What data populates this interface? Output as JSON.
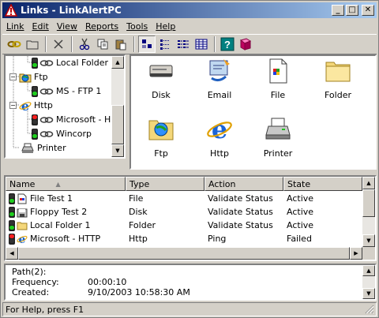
{
  "window": {
    "title": "Links - LinkAlertPC",
    "minimize": "_",
    "maximize": "□",
    "close": "✕"
  },
  "menu": [
    {
      "label": "Link"
    },
    {
      "label": "Edit"
    },
    {
      "label": "View"
    },
    {
      "label": "Reports"
    },
    {
      "label": "Tools"
    },
    {
      "label": "Help"
    }
  ],
  "toolbar": {
    "buttons": [
      "link-icon",
      "open-folder-icon",
      "delete-icon",
      "cut-icon",
      "copy-icon",
      "paste-icon",
      "large-icons-icon",
      "small-icons-icon",
      "list-view-icon",
      "details-view-icon",
      "help-icon",
      "book-icon"
    ]
  },
  "tree": {
    "items": [
      {
        "label": "Local Folder",
        "status": "green",
        "indent": 2
      },
      {
        "label": "Ftp",
        "expander": "−",
        "indent": 0
      },
      {
        "label": "MS - FTP 1",
        "status": "green",
        "indent": 2
      },
      {
        "label": "Http",
        "expander": "−",
        "indent": 0
      },
      {
        "label": "Microsoft - H",
        "status": "red",
        "indent": 2
      },
      {
        "label": "Wincorp",
        "status": "green",
        "indent": 2
      },
      {
        "label": "Printer",
        "indent": 1
      }
    ]
  },
  "icons": [
    {
      "label": "Disk",
      "icon": "disk-icon"
    },
    {
      "label": "Email",
      "icon": "email-icon"
    },
    {
      "label": "File",
      "icon": "file-icon"
    },
    {
      "label": "Folder",
      "icon": "folder-icon"
    },
    {
      "label": "Ftp",
      "icon": "ftp-folder-icon"
    },
    {
      "label": "Http",
      "icon": "ie-icon"
    },
    {
      "label": "Printer",
      "icon": "printer-icon"
    }
  ],
  "list": {
    "columns": [
      {
        "label": "Name"
      },
      {
        "label": "Type"
      },
      {
        "label": "Action"
      },
      {
        "label": "State"
      }
    ],
    "sort_indicator": "▲",
    "rows": [
      {
        "status": "green",
        "name": "File Test 1",
        "type": "File",
        "action": "Validate Status",
        "state": "Active"
      },
      {
        "status": "green",
        "name": "Floppy Test 2",
        "type": "Disk",
        "action": "Validate Status",
        "state": "Active"
      },
      {
        "status": "green",
        "name": "Local Folder 1",
        "type": "Folder",
        "action": "Validate Status",
        "state": "Active"
      },
      {
        "status": "red",
        "name": "Microsoft - HTTP",
        "type": "Http",
        "action": "Ping",
        "state": "Failed"
      }
    ]
  },
  "details": {
    "rows": [
      {
        "key": "Path(2):",
        "value": ""
      },
      {
        "key": "Frequency:",
        "value": "00:00:10"
      },
      {
        "key": "Created:",
        "value": "9/10/2003 10:58:30 AM"
      }
    ]
  },
  "status": {
    "text": "For Help, press F1"
  },
  "colors": {
    "title_start": "#0a246a",
    "title_end": "#a6caf0",
    "face": "#d4d0c8",
    "ok": "#1fcf1f",
    "fail": "#ff2020"
  }
}
